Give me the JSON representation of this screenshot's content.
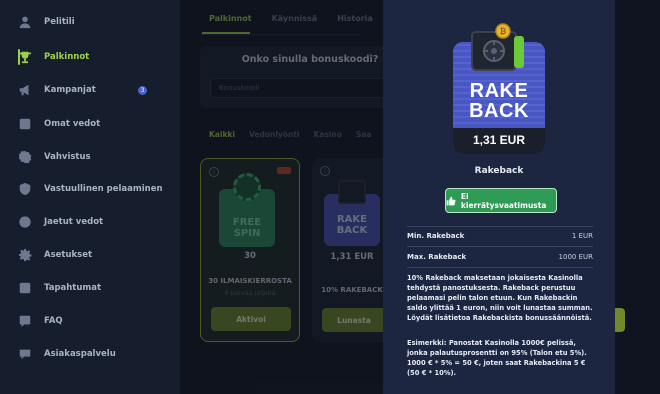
{
  "sidebar": {
    "items": [
      {
        "label": "Pelitili",
        "icon": "user-icon"
      },
      {
        "label": "Palkinnot",
        "icon": "trophy-icon"
      },
      {
        "label": "Kampanjat",
        "icon": "megaphone-icon",
        "badge": "3"
      },
      {
        "label": "Omat vedot",
        "icon": "ticket-icon"
      },
      {
        "label": "Vahvistus",
        "icon": "verified-icon"
      },
      {
        "label": "Vastuullinen pelaaminen",
        "icon": "shield-icon"
      },
      {
        "label": "Jaetut vedot",
        "icon": "share-icon"
      },
      {
        "label": "Asetukset",
        "icon": "gear-icon"
      },
      {
        "label": "Tapahtumat",
        "icon": "list-icon"
      },
      {
        "label": "FAQ",
        "icon": "help-icon"
      },
      {
        "label": "Asiakaspalvelu",
        "icon": "chat-icon"
      }
    ],
    "active_index": 1
  },
  "main": {
    "tabs": [
      "Palkinnot",
      "Käynnissä",
      "Historia"
    ],
    "bonus": {
      "title": "Onko sinulla bonuskoodi?",
      "placeholder": "Bonuskoodi"
    },
    "filters": [
      "Kaikki",
      "Vedonlyönti",
      "Kasino",
      "Saa"
    ],
    "cards": [
      {
        "tile_line1": "FREE",
        "tile_line2": "SPIN",
        "value": "30",
        "subtitle": "30 ILMAISKIERROSTA",
        "note": "6 päivää jäljellä",
        "button": "Aktivoi"
      },
      {
        "tile_line1": "RAKE",
        "tile_line2": "BACK",
        "value": "1,31 EUR",
        "subtitle": "10% RAKEBACK",
        "note": "",
        "button": "Lunasta"
      }
    ]
  },
  "panel": {
    "hero_line1": "RAKE",
    "hero_line2": "BACK",
    "hero_amount": "1,31 EUR",
    "reward_name": "Rakeback",
    "wager_button": "Ei kierrätysvaatimusta",
    "rows": [
      {
        "label": "Min. Rakeback",
        "value": "1 EUR"
      },
      {
        "label": "Max. Rakeback",
        "value": "1000 EUR"
      }
    ],
    "description": "10% Rakeback maksetaan jokaisesta Kasinolla tehdystä panostuksesta. Rakeback perustuu pelaamasi pelin talon etuun. Kun Rakebackin saldo ylittää 1 euron, niin voit lunastaa summan. Löydät lisätietoa Rakebackista bonussäännöistä.",
    "example": "Esimerkki: Panostat Kasinolla 1000€ pelissä, jonka palautusprosentti on 95% (Talon etu 5%). 1000 € * 5% = 50 €, joten saat Rakebackina 5 € (50 € * 10%)."
  },
  "colors": {
    "accent": "#9fd04a",
    "panel": "#1d2640",
    "rakeback": "#4f5cc8",
    "wager_green": "#2f9a56"
  }
}
